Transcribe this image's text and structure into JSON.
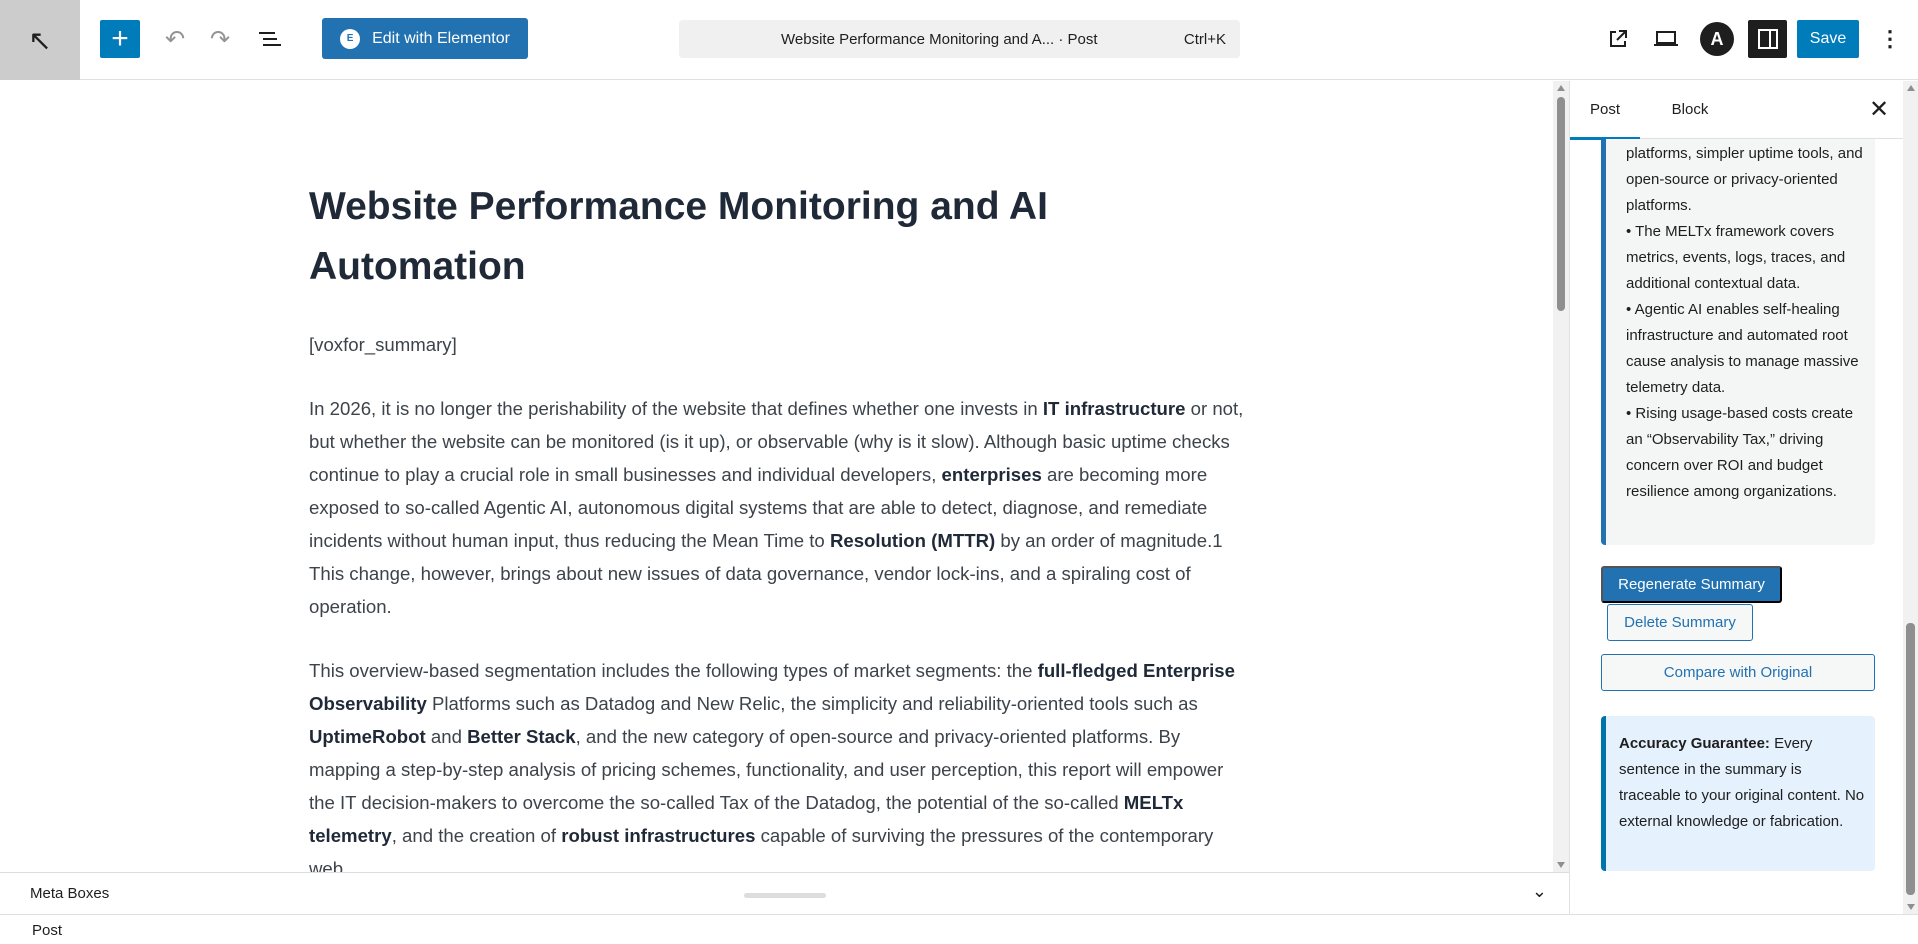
{
  "header": {
    "back_icon": "arrow-up-left-icon",
    "add_icon": "plus-icon",
    "undo_icon": "undo-icon",
    "redo_icon": "redo-icon",
    "list_icon": "document-overview-icon",
    "elementor_label": "Edit with Elementor",
    "elementor_logo": "E",
    "command_title": "Website Performance Monitoring and A...  · Post",
    "command_shortcut": "Ctrl+K",
    "astra_logo": "A",
    "save_label": "Save"
  },
  "post": {
    "title": "Website Performance Monitoring and AI Automation",
    "shortcode": "[voxfor_summary]",
    "paragraphs": [
      [
        {
          "t": "In 2026, it is no longer the perishability of the website that defines whether one invests in "
        },
        {
          "t": "IT infrastructure",
          "b": true
        },
        {
          "t": " or not, but whether the website can be monitored (is it up), or observable (why is it slow). Although basic uptime checks continue to play a crucial role in small businesses and individual developers, "
        },
        {
          "t": "enterprises",
          "b": true
        },
        {
          "t": " are becoming more exposed to so-called Agentic AI, autonomous digital systems that are able to detect, diagnose, and remediate incidents without human input, thus reducing the Mean Time to "
        },
        {
          "t": "Resolution (MTTR)",
          "b": true
        },
        {
          "t": " by an order of magnitude.1 This change, however, brings about new issues of data governance, vendor lock-ins, and a spiraling cost of operation."
        }
      ],
      [
        {
          "t": "This overview-based segmentation includes the following types of market segments: the "
        },
        {
          "t": "full-fledged Enterprise Observability",
          "b": true
        },
        {
          "t": " Platforms such as Datadog and New Relic, the simplicity and reliability-oriented tools such as "
        },
        {
          "t": "UptimeRobot",
          "b": true
        },
        {
          "t": " and "
        },
        {
          "t": "Better Stack",
          "b": true
        },
        {
          "t": ", and the new category of open-source and privacy-oriented platforms. By mapping a step-by-step analysis of pricing schemes, functionality, and user perception, this report will empower the IT decision-makers to overcome the so-called Tax of the Datadog, the potential of the so-called "
        },
        {
          "t": "MELTx telemetry",
          "b": true
        },
        {
          "t": ", and the creation of "
        },
        {
          "t": "robust infrastructures",
          "b": true
        },
        {
          "t": " capable of surviving the pressures of the contemporary web."
        }
      ]
    ]
  },
  "meta_boxes": {
    "label": "Meta Boxes"
  },
  "footer": {
    "breadcrumb": "Post"
  },
  "sidebar": {
    "tabs": [
      {
        "label": "Post"
      },
      {
        "label": "Block"
      }
    ],
    "summary_lines": "platforms, simpler uptime tools, and open-source or privacy-oriented platforms.\n• The MELTx framework covers metrics, events, logs, traces, and additional contextual data.\n• Agentic AI enables self-healing infrastructure and automated root cause analysis to manage massive telemetry data.\n• Rising usage-based costs create an “Observability Tax,” driving concern over ROI and budget resilience among organizations.",
    "regenerate_label": "Regenerate Summary",
    "delete_label": "Delete Summary",
    "compare_label": "Compare with Original",
    "accuracy_title": "Accuracy Guarantee:",
    "accuracy_text": " Every sentence in the summary is traceable to your original content. No external knowledge or fabrication."
  },
  "colors": {
    "accent": "#007cba",
    "button": "#2271b1",
    "notice_bg": "#e5f1fc"
  }
}
